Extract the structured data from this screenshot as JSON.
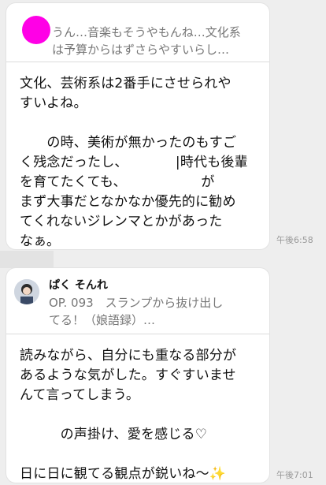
{
  "messages": [
    {
      "quote": {
        "text": "うん…音楽もそうやもんね…文化系\nは予算からはずさらやすいらし…",
        "avatar_color": "#ff00e6"
      },
      "body": "文化、芸術系は2番手にさせられや\nすいよね。\n\n　　の時、美術が無かったのもすご\nく残念だったし、　　　　|時代も後輩\nを育てたくても、　　　　　　が\nまず大事だとなかなか優先的に勧め\nてくれないジレンマとかがあった\nなぁ。",
      "time": "午後6:58"
    },
    {
      "sender": "ぱく そんれ",
      "quote": {
        "text": "OP. 093　スランプから抜け出し\nてる！（娘語録）…"
      },
      "body": "読みながら、自分にも重なる部分が\nあるような気がした。すぐすいませ\nんて言ってしまう。\n\n　　　の声掛け、愛を感じる♡\n\n日に日に観てる観点が鋭いね〜",
      "sparkle": "✨",
      "time": "午後7:01"
    }
  ]
}
